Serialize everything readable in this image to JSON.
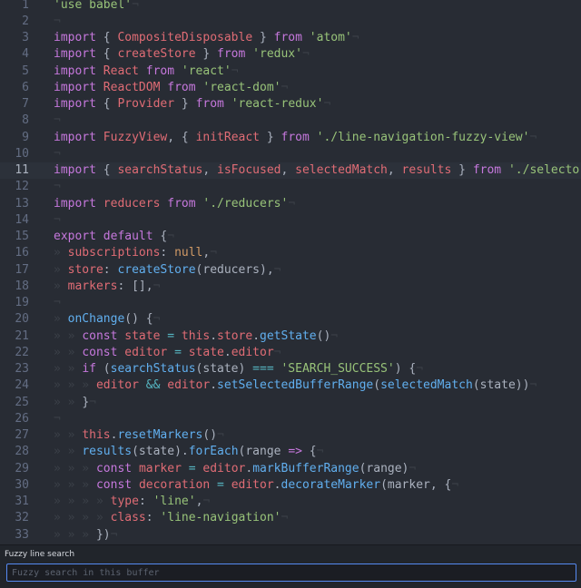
{
  "editor": {
    "lines": [
      {
        "n": "1",
        "tokens": [
          {
            "t": "'use babel'",
            "c": "str"
          },
          {
            "t": "¬",
            "c": "inv"
          }
        ]
      },
      {
        "n": "2",
        "tokens": [
          {
            "t": "¬",
            "c": "inv"
          }
        ]
      },
      {
        "n": "3",
        "tokens": [
          {
            "t": "import",
            "c": "kw"
          },
          {
            "t": " { ",
            "c": "plain"
          },
          {
            "t": "CompositeDisposable",
            "c": "cls"
          },
          {
            "t": " } ",
            "c": "plain"
          },
          {
            "t": "from",
            "c": "kw"
          },
          {
            "t": " ",
            "c": "plain"
          },
          {
            "t": "'atom'",
            "c": "str"
          },
          {
            "t": "¬",
            "c": "inv"
          }
        ]
      },
      {
        "n": "4",
        "tokens": [
          {
            "t": "import",
            "c": "kw"
          },
          {
            "t": " { ",
            "c": "plain"
          },
          {
            "t": "createStore",
            "c": "cls"
          },
          {
            "t": " } ",
            "c": "plain"
          },
          {
            "t": "from",
            "c": "kw"
          },
          {
            "t": " ",
            "c": "plain"
          },
          {
            "t": "'redux'",
            "c": "str"
          },
          {
            "t": "¬",
            "c": "inv"
          }
        ]
      },
      {
        "n": "5",
        "tokens": [
          {
            "t": "import",
            "c": "kw"
          },
          {
            "t": " ",
            "c": "plain"
          },
          {
            "t": "React",
            "c": "cls"
          },
          {
            "t": " ",
            "c": "plain"
          },
          {
            "t": "from",
            "c": "kw"
          },
          {
            "t": " ",
            "c": "plain"
          },
          {
            "t": "'react'",
            "c": "str"
          },
          {
            "t": "¬",
            "c": "inv"
          }
        ]
      },
      {
        "n": "6",
        "tokens": [
          {
            "t": "import",
            "c": "kw"
          },
          {
            "t": " ",
            "c": "plain"
          },
          {
            "t": "ReactDOM",
            "c": "cls"
          },
          {
            "t": " ",
            "c": "plain"
          },
          {
            "t": "from",
            "c": "kw"
          },
          {
            "t": " ",
            "c": "plain"
          },
          {
            "t": "'react-dom'",
            "c": "str"
          },
          {
            "t": "¬",
            "c": "inv"
          }
        ]
      },
      {
        "n": "7",
        "tokens": [
          {
            "t": "import",
            "c": "kw"
          },
          {
            "t": " { ",
            "c": "plain"
          },
          {
            "t": "Provider",
            "c": "cls"
          },
          {
            "t": " } ",
            "c": "plain"
          },
          {
            "t": "from",
            "c": "kw"
          },
          {
            "t": " ",
            "c": "plain"
          },
          {
            "t": "'react-redux'",
            "c": "str"
          },
          {
            "t": "¬",
            "c": "inv"
          }
        ]
      },
      {
        "n": "8",
        "tokens": [
          {
            "t": "¬",
            "c": "inv"
          }
        ]
      },
      {
        "n": "9",
        "tokens": [
          {
            "t": "import",
            "c": "kw"
          },
          {
            "t": " ",
            "c": "plain"
          },
          {
            "t": "FuzzyView",
            "c": "cls"
          },
          {
            "t": ", { ",
            "c": "plain"
          },
          {
            "t": "initReact",
            "c": "cls"
          },
          {
            "t": " } ",
            "c": "plain"
          },
          {
            "t": "from",
            "c": "kw"
          },
          {
            "t": " ",
            "c": "plain"
          },
          {
            "t": "'./line-navigation-fuzzy-view'",
            "c": "str"
          },
          {
            "t": "¬",
            "c": "inv"
          }
        ]
      },
      {
        "n": "10",
        "tokens": [
          {
            "t": "¬",
            "c": "inv"
          }
        ]
      },
      {
        "n": "11",
        "cursor": true,
        "tokens": [
          {
            "t": "import",
            "c": "kw"
          },
          {
            "t": " { ",
            "c": "plain"
          },
          {
            "t": "searchStatus",
            "c": "cls"
          },
          {
            "t": ", ",
            "c": "plain"
          },
          {
            "t": "isFocused",
            "c": "cls"
          },
          {
            "t": ", ",
            "c": "plain"
          },
          {
            "t": "selectedMatch",
            "c": "cls"
          },
          {
            "t": ", ",
            "c": "plain"
          },
          {
            "t": "results",
            "c": "cls"
          },
          {
            "t": " } ",
            "c": "plain"
          },
          {
            "t": "from",
            "c": "kw"
          },
          {
            "t": " ",
            "c": "plain"
          },
          {
            "t": "'./selectors'",
            "c": "str"
          },
          {
            "t": "¬",
            "c": "inv"
          }
        ]
      },
      {
        "n": "12",
        "tokens": [
          {
            "t": "¬",
            "c": "inv"
          }
        ]
      },
      {
        "n": "13",
        "tokens": [
          {
            "t": "import",
            "c": "kw"
          },
          {
            "t": " ",
            "c": "plain"
          },
          {
            "t": "reducers",
            "c": "cls"
          },
          {
            "t": " ",
            "c": "plain"
          },
          {
            "t": "from",
            "c": "kw"
          },
          {
            "t": " ",
            "c": "plain"
          },
          {
            "t": "'./reducers'",
            "c": "str"
          },
          {
            "t": "¬",
            "c": "inv"
          }
        ]
      },
      {
        "n": "14",
        "tokens": [
          {
            "t": "¬",
            "c": "inv"
          }
        ]
      },
      {
        "n": "15",
        "tokens": [
          {
            "t": "export",
            "c": "kw"
          },
          {
            "t": " ",
            "c": "plain"
          },
          {
            "t": "default",
            "c": "kw"
          },
          {
            "t": " {",
            "c": "plain"
          },
          {
            "t": "¬",
            "c": "inv"
          }
        ]
      },
      {
        "n": "16",
        "tokens": [
          {
            "t": "» ",
            "c": "inv"
          },
          {
            "t": "subscriptions",
            "c": "cls"
          },
          {
            "t": ": ",
            "c": "plain"
          },
          {
            "t": "null",
            "c": "num"
          },
          {
            "t": ",",
            "c": "plain"
          },
          {
            "t": "¬",
            "c": "inv"
          }
        ]
      },
      {
        "n": "17",
        "tokens": [
          {
            "t": "» ",
            "c": "inv"
          },
          {
            "t": "store",
            "c": "cls"
          },
          {
            "t": ": ",
            "c": "plain"
          },
          {
            "t": "createStore",
            "c": "fn"
          },
          {
            "t": "(reducers),",
            "c": "plain"
          },
          {
            "t": "¬",
            "c": "inv"
          }
        ]
      },
      {
        "n": "18",
        "tokens": [
          {
            "t": "» ",
            "c": "inv"
          },
          {
            "t": "markers",
            "c": "cls"
          },
          {
            "t": ": [],",
            "c": "plain"
          },
          {
            "t": "¬",
            "c": "inv"
          }
        ]
      },
      {
        "n": "19",
        "tokens": [
          {
            "t": "¬",
            "c": "inv"
          }
        ]
      },
      {
        "n": "20",
        "tokens": [
          {
            "t": "» ",
            "c": "inv"
          },
          {
            "t": "onChange",
            "c": "fn"
          },
          {
            "t": "() {",
            "c": "plain"
          },
          {
            "t": "¬",
            "c": "inv"
          }
        ]
      },
      {
        "n": "21",
        "tokens": [
          {
            "t": "» » ",
            "c": "inv"
          },
          {
            "t": "const",
            "c": "kw"
          },
          {
            "t": " ",
            "c": "plain"
          },
          {
            "t": "state",
            "c": "cls"
          },
          {
            "t": " = ",
            "c": "op"
          },
          {
            "t": "this",
            "c": "cls"
          },
          {
            "t": ".",
            "c": "plain"
          },
          {
            "t": "store",
            "c": "cls"
          },
          {
            "t": ".",
            "c": "plain"
          },
          {
            "t": "getState",
            "c": "fn"
          },
          {
            "t": "()",
            "c": "plain"
          },
          {
            "t": "¬",
            "c": "inv"
          }
        ]
      },
      {
        "n": "22",
        "tokens": [
          {
            "t": "» » ",
            "c": "inv"
          },
          {
            "t": "const",
            "c": "kw"
          },
          {
            "t": " ",
            "c": "plain"
          },
          {
            "t": "editor",
            "c": "cls"
          },
          {
            "t": " = ",
            "c": "op"
          },
          {
            "t": "state",
            "c": "cls"
          },
          {
            "t": ".",
            "c": "plain"
          },
          {
            "t": "editor",
            "c": "cls"
          },
          {
            "t": "¬",
            "c": "inv"
          }
        ]
      },
      {
        "n": "23",
        "tokens": [
          {
            "t": "» » ",
            "c": "inv"
          },
          {
            "t": "if",
            "c": "kw"
          },
          {
            "t": " (",
            "c": "plain"
          },
          {
            "t": "searchStatus",
            "c": "fn"
          },
          {
            "t": "(state) ",
            "c": "plain"
          },
          {
            "t": "===",
            "c": "op"
          },
          {
            "t": " ",
            "c": "plain"
          },
          {
            "t": "'SEARCH_SUCCESS'",
            "c": "str"
          },
          {
            "t": ") {",
            "c": "plain"
          },
          {
            "t": "¬",
            "c": "inv"
          }
        ]
      },
      {
        "n": "24",
        "tokens": [
          {
            "t": "» » » ",
            "c": "inv"
          },
          {
            "t": "editor",
            "c": "cls"
          },
          {
            "t": " && ",
            "c": "op"
          },
          {
            "t": "editor",
            "c": "cls"
          },
          {
            "t": ".",
            "c": "plain"
          },
          {
            "t": "setSelectedBufferRange",
            "c": "fn"
          },
          {
            "t": "(",
            "c": "plain"
          },
          {
            "t": "selectedMatch",
            "c": "fn"
          },
          {
            "t": "(state))",
            "c": "plain"
          },
          {
            "t": "¬",
            "c": "inv"
          }
        ]
      },
      {
        "n": "25",
        "tokens": [
          {
            "t": "» » ",
            "c": "inv"
          },
          {
            "t": "}",
            "c": "plain"
          },
          {
            "t": "¬",
            "c": "inv"
          }
        ]
      },
      {
        "n": "26",
        "tokens": [
          {
            "t": "¬",
            "c": "inv"
          }
        ]
      },
      {
        "n": "27",
        "tokens": [
          {
            "t": "» » ",
            "c": "inv"
          },
          {
            "t": "this",
            "c": "cls"
          },
          {
            "t": ".",
            "c": "plain"
          },
          {
            "t": "resetMarkers",
            "c": "fn"
          },
          {
            "t": "()",
            "c": "plain"
          },
          {
            "t": "¬",
            "c": "inv"
          }
        ]
      },
      {
        "n": "28",
        "tokens": [
          {
            "t": "» » ",
            "c": "inv"
          },
          {
            "t": "results",
            "c": "fn"
          },
          {
            "t": "(state).",
            "c": "plain"
          },
          {
            "t": "forEach",
            "c": "fn"
          },
          {
            "t": "(range ",
            "c": "plain"
          },
          {
            "t": "=>",
            "c": "kw"
          },
          {
            "t": " {",
            "c": "plain"
          },
          {
            "t": "¬",
            "c": "inv"
          }
        ]
      },
      {
        "n": "29",
        "tokens": [
          {
            "t": "» » » ",
            "c": "inv"
          },
          {
            "t": "const",
            "c": "kw"
          },
          {
            "t": " ",
            "c": "plain"
          },
          {
            "t": "marker",
            "c": "cls"
          },
          {
            "t": " = ",
            "c": "op"
          },
          {
            "t": "editor",
            "c": "cls"
          },
          {
            "t": ".",
            "c": "plain"
          },
          {
            "t": "markBufferRange",
            "c": "fn"
          },
          {
            "t": "(range)",
            "c": "plain"
          },
          {
            "t": "¬",
            "c": "inv"
          }
        ]
      },
      {
        "n": "30",
        "tokens": [
          {
            "t": "» » » ",
            "c": "inv"
          },
          {
            "t": "const",
            "c": "kw"
          },
          {
            "t": " ",
            "c": "plain"
          },
          {
            "t": "decoration",
            "c": "cls"
          },
          {
            "t": " = ",
            "c": "op"
          },
          {
            "t": "editor",
            "c": "cls"
          },
          {
            "t": ".",
            "c": "plain"
          },
          {
            "t": "decorateMarker",
            "c": "fn"
          },
          {
            "t": "(marker, {",
            "c": "plain"
          },
          {
            "t": "¬",
            "c": "inv"
          }
        ]
      },
      {
        "n": "31",
        "tokens": [
          {
            "t": "» » » » ",
            "c": "inv"
          },
          {
            "t": "type",
            "c": "cls"
          },
          {
            "t": ": ",
            "c": "plain"
          },
          {
            "t": "'line'",
            "c": "str"
          },
          {
            "t": ",",
            "c": "plain"
          },
          {
            "t": "¬",
            "c": "inv"
          }
        ]
      },
      {
        "n": "32",
        "tokens": [
          {
            "t": "» » » » ",
            "c": "inv"
          },
          {
            "t": "class",
            "c": "cls"
          },
          {
            "t": ": ",
            "c": "plain"
          },
          {
            "t": "'line-navigation'",
            "c": "str"
          },
          {
            "t": "¬",
            "c": "inv"
          }
        ]
      },
      {
        "n": "33",
        "tokens": [
          {
            "t": "» » » ",
            "c": "inv"
          },
          {
            "t": "})",
            "c": "plain"
          },
          {
            "t": "¬",
            "c": "inv"
          }
        ]
      }
    ]
  },
  "panel": {
    "label": "Fuzzy line search",
    "placeholder": "Fuzzy search in this buffer",
    "value": ""
  },
  "colors": {
    "editor_bg": "#282c34",
    "string": "#98c379",
    "keyword": "#c678dd",
    "identifier": "#e06c75",
    "function": "#61afef",
    "constant": "#d19a66",
    "operator": "#56b6c2",
    "focus_border": "#568af2"
  }
}
